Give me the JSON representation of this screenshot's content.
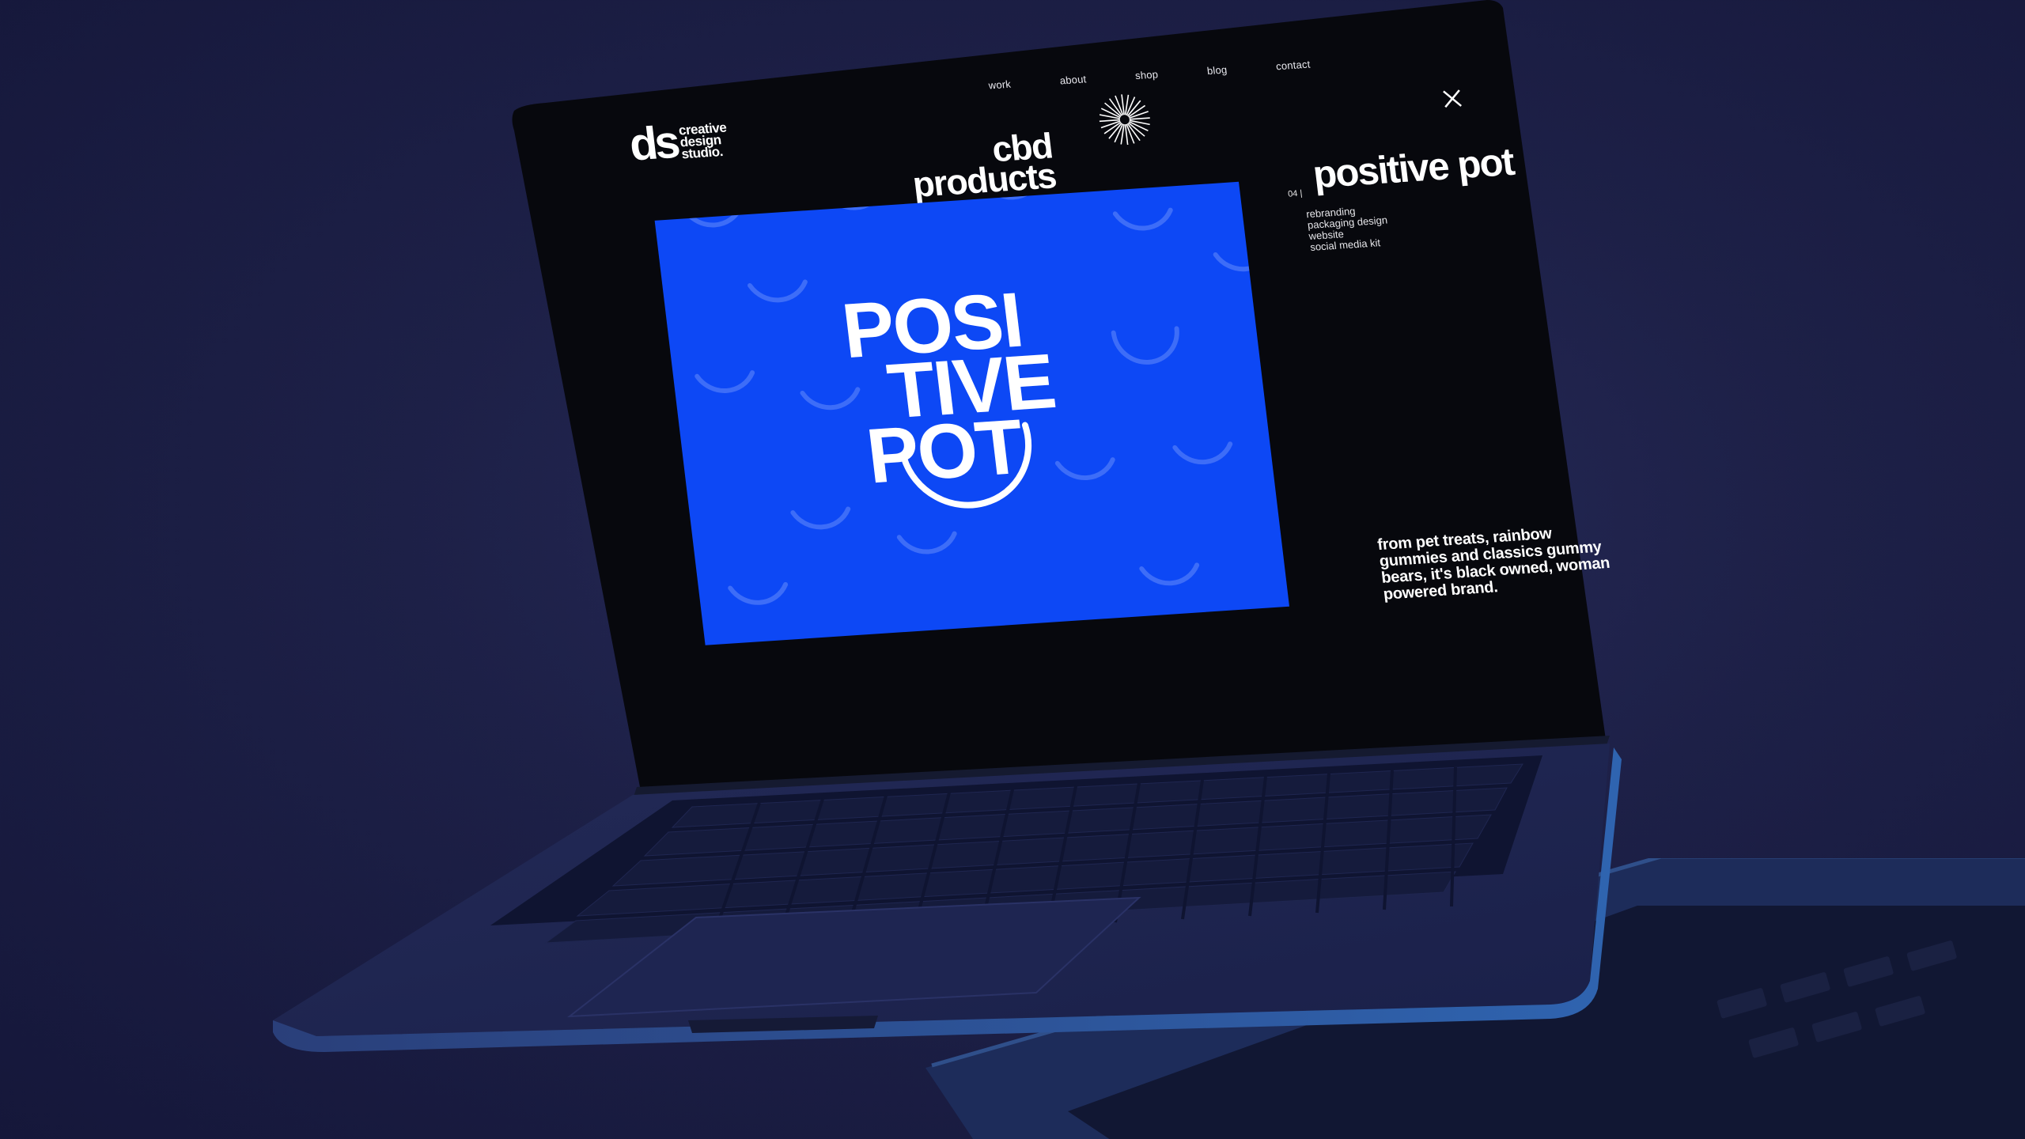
{
  "nav": {
    "items": [
      "work",
      "about",
      "shop",
      "blog",
      "contact"
    ]
  },
  "logo": {
    "mark": "ds",
    "tagline": "creative\ndesign\nstudio."
  },
  "category": {
    "line1": "cbd",
    "line2": "products"
  },
  "hero": {
    "row1": "POSI",
    "row2": "TIVE",
    "row3": "POT"
  },
  "project": {
    "number": "04 |",
    "title": "positive pot",
    "services": [
      "rebranding",
      "packaging design",
      "website",
      "social media kit"
    ],
    "description": "from pet treats, rainbow gummies and classics gummy bears, it's black owned, woman powered brand."
  },
  "icons": {
    "close": "close-icon",
    "burst": "starburst-icon"
  },
  "colors": {
    "brand_blue": "#0d48f5",
    "screen_bg": "#040407",
    "bg_navy": "#1d2047"
  }
}
